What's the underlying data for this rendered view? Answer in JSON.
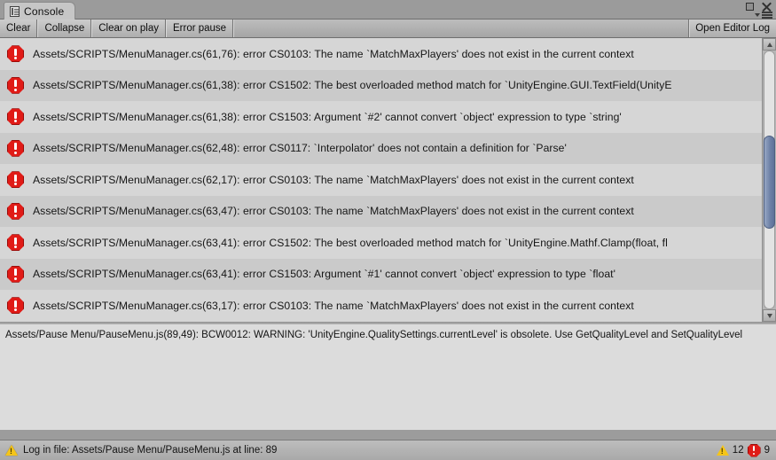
{
  "window": {
    "tab_label": "Console",
    "tab_icon": "document-list-icon",
    "maximize_icon": "maximize-icon",
    "close_icon": "close-icon",
    "options_icon": "options-menu-icon"
  },
  "toolbar": {
    "clear_label": "Clear",
    "collapse_label": "Collapse",
    "clear_on_play_label": "Clear on play",
    "error_pause_label": "Error pause",
    "open_editor_log_label": "Open Editor Log"
  },
  "log": {
    "entries": [
      {
        "icon": "error-icon",
        "text": "Assets/SCRIPTS/MenuManager.cs(61,76): error CS0103: The name `MatchMaxPlayers' does not exist in the current context"
      },
      {
        "icon": "error-icon",
        "text": "Assets/SCRIPTS/MenuManager.cs(61,38): error CS1502: The best overloaded method match for `UnityEngine.GUI.TextField(UnityE"
      },
      {
        "icon": "error-icon",
        "text": "Assets/SCRIPTS/MenuManager.cs(61,38): error CS1503: Argument `#2' cannot convert `object' expression to type `string'"
      },
      {
        "icon": "error-icon",
        "text": "Assets/SCRIPTS/MenuManager.cs(62,48): error CS0117: `Interpolator' does not contain a definition for `Parse'"
      },
      {
        "icon": "error-icon",
        "text": "Assets/SCRIPTS/MenuManager.cs(62,17): error CS0103: The name `MatchMaxPlayers' does not exist in the current context"
      },
      {
        "icon": "error-icon",
        "text": "Assets/SCRIPTS/MenuManager.cs(63,47): error CS0103: The name `MatchMaxPlayers' does not exist in the current context"
      },
      {
        "icon": "error-icon",
        "text": "Assets/SCRIPTS/MenuManager.cs(63,41): error CS1502: The best overloaded method match for `UnityEngine.Mathf.Clamp(float, fl"
      },
      {
        "icon": "error-icon",
        "text": "Assets/SCRIPTS/MenuManager.cs(63,41): error CS1503: Argument `#1' cannot convert `object' expression to type `float'"
      },
      {
        "icon": "error-icon",
        "text": "Assets/SCRIPTS/MenuManager.cs(63,17): error CS0103: The name `MatchMaxPlayers' does not exist in the current context"
      }
    ]
  },
  "detail": {
    "text": "Assets/Pause Menu/PauseMenu.js(89,49): BCW0012: WARNING: 'UnityEngine.QualitySettings.currentLevel' is obsolete. Use GetQualityLevel and SetQualityLevel"
  },
  "status": {
    "icon": "warning-icon",
    "message": "Log in file: Assets/Pause Menu/PauseMenu.js at line: 89",
    "warning_count": "12",
    "error_count": "9"
  },
  "colors": {
    "error_red": "#e01b17",
    "warning_yellow": "#f5c518",
    "scrollbar_thumb": "#6f82a8",
    "chrome": "#9c9c9c",
    "row_light": "#d6d6d6",
    "row_dark": "#cacaca"
  }
}
